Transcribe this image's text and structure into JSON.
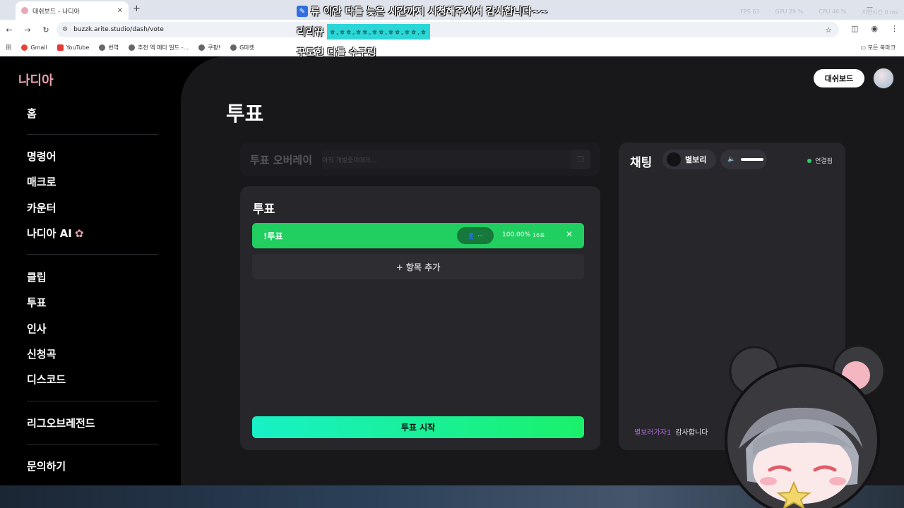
{
  "browser": {
    "tab_title": "대쉬보드 - 나디아",
    "url": "buzzk.arite.studio/dash/vote",
    "bookmarks": [
      "Gmail",
      "YouTube",
      "번역",
      "추천 엑 메타 빌드 -...",
      "쿠팡!",
      "G마켓"
    ],
    "bookmarks_folder": "모든 북마크",
    "stats": {
      "fps_label": "FPS",
      "fps": "63",
      "gpu_label": "GPU",
      "gpu": "29 %",
      "cpu_label": "CPU",
      "cpu": "46 %",
      "delay_label": "지연시간",
      "delay": "0 ms"
    }
  },
  "stream_overlay": {
    "line1": "류 이안  다들 늦은 시간까지 시청해주셔서 감사합니다~~",
    "line2_user": "리리뀨",
    "line2_emotes": "ㅎ.ㅎㅎ.ㅎㅎ.ㅎㅎ.ㅎㅎ.ㅎㅎ.ㅎ",
    "line3": "꾸도힌  다들 수구링"
  },
  "app": {
    "brand": "나디아",
    "dashboard_button": "대쉬보드",
    "page_title": "투표"
  },
  "sidebar": {
    "items": [
      "홈",
      "명령어",
      "매크로",
      "카운터",
      "나디아 AI",
      "클립",
      "투표",
      "인사",
      "신청곡",
      "디스코드",
      "리그오브레전드",
      "문의하기"
    ]
  },
  "overlay_panel": {
    "title": "투표 오버레이",
    "placeholder": "아직 개발중이에요..."
  },
  "vote": {
    "heading": "투표",
    "options": [
      {
        "name": "!투표",
        "percent": "100.00%",
        "count": "16표",
        "share": 1.0
      }
    ],
    "add_item": "+ 항목 추가",
    "start_button": "투표 시작"
  },
  "chat": {
    "title": "채팅",
    "channel": "별보리",
    "status": "연결됨",
    "messages": [
      {
        "user": "별보러가자1",
        "text": "감사합니다"
      }
    ]
  },
  "colors": {
    "accent_green": "#21cf60",
    "brand_pink": "#e7a0ad",
    "chat_user": "#b06ad6"
  }
}
